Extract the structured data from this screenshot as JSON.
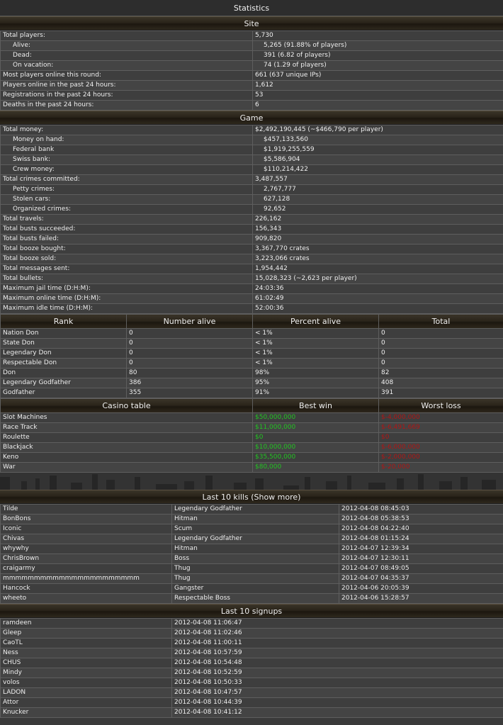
{
  "title": "Statistics",
  "site": {
    "heading": "Site",
    "rows": [
      {
        "label": "Total players:",
        "value": "5,730",
        "sub": false
      },
      {
        "label": "Alive:",
        "value": "5,265 (91.88% of players)",
        "sub": true
      },
      {
        "label": "Dead:",
        "value": "391 (6.82 of players)",
        "sub": true
      },
      {
        "label": "On vacation:",
        "value": "74 (1.29 of players)",
        "sub": true
      },
      {
        "label": "Most players online this round:",
        "value": "661 (637 unique IPs)",
        "sub": false
      },
      {
        "label": "Players online in the past 24 hours:",
        "value": "1,612",
        "sub": false
      },
      {
        "label": "Registrations in the past 24 hours:",
        "value": "53",
        "sub": false
      },
      {
        "label": "Deaths in the past 24 hours:",
        "value": "6",
        "sub": false
      }
    ]
  },
  "game": {
    "heading": "Game",
    "rows": [
      {
        "label": "Total money:",
        "value": "$2,492,190,445 (~$466,790 per player)",
        "sub": false
      },
      {
        "label": "Money on hand:",
        "value": "$457,133,560",
        "sub": true
      },
      {
        "label": "Federal bank",
        "value": "$1,919,255,559",
        "sub": true
      },
      {
        "label": "Swiss bank:",
        "value": "$5,586,904",
        "sub": true
      },
      {
        "label": "Crew money:",
        "value": "$110,214,422",
        "sub": true
      },
      {
        "label": "Total crimes committed:",
        "value": "3,487,557",
        "sub": false
      },
      {
        "label": "Petty crimes:",
        "value": "2,767,777",
        "sub": true
      },
      {
        "label": "Stolen cars:",
        "value": "627,128",
        "sub": true
      },
      {
        "label": "Organized crimes:",
        "value": "92,652",
        "sub": true
      },
      {
        "label": "Total travels:",
        "value": "226,162",
        "sub": false
      },
      {
        "label": "Total busts succeeded:",
        "value": "156,343",
        "sub": false
      },
      {
        "label": "Total busts failed:",
        "value": "909,820",
        "sub": false
      },
      {
        "label": "Total booze bought:",
        "value": "3,367,770 crates",
        "sub": false
      },
      {
        "label": "Total booze sold:",
        "value": "3,223,066 crates",
        "sub": false
      },
      {
        "label": "Total messages sent:",
        "value": "1,954,442",
        "sub": false
      },
      {
        "label": "Total bullets:",
        "value": "15,028,323 (~2,623 per player)",
        "sub": false
      },
      {
        "label": "Maximum jail time (D:H:M):",
        "value": "24:03:36",
        "sub": false
      },
      {
        "label": "Maximum online time (D:H:M):",
        "value": "61:02:49",
        "sub": false
      },
      {
        "label": "Maximum idle time (D:H:M):",
        "value": "52:00:36",
        "sub": false
      }
    ]
  },
  "rank": {
    "headers": [
      "Rank",
      "Number alive",
      "Percent alive",
      "Total"
    ],
    "rows": [
      [
        "Nation Don",
        "0",
        "< 1%",
        "0"
      ],
      [
        "State Don",
        "0",
        "< 1%",
        "0"
      ],
      [
        "Legendary Don",
        "0",
        "< 1%",
        "0"
      ],
      [
        "Respectable Don",
        "0",
        "< 1%",
        "0"
      ],
      [
        "Don",
        "80",
        "98%",
        "82"
      ],
      [
        "Legendary Godfather",
        "386",
        "95%",
        "408"
      ],
      [
        "Godfather",
        "355",
        "91%",
        "391"
      ]
    ]
  },
  "casino": {
    "headers": [
      "Casino table",
      "Best win",
      "Worst loss"
    ],
    "rows": [
      [
        "Slot Machines",
        "$50,000,000",
        "$-4,000,000"
      ],
      [
        "Race Track",
        "$11,000,000",
        "$-6,491,669"
      ],
      [
        "Roulette",
        "$0",
        "$0"
      ],
      [
        "Blackjack",
        "$10,000,000",
        "$-6,000,000"
      ],
      [
        "Keno",
        "$35,500,000",
        "$-2,000,000"
      ],
      [
        "War",
        "$80,000",
        "$-20,000"
      ]
    ],
    "colors": {
      "win": "#22c322",
      "loss": "#b01616"
    }
  },
  "kills": {
    "heading": "Last 10 kills (Show more)",
    "rows": [
      [
        "Tilde",
        "Legendary Godfather",
        "2012-04-08 08:45:03"
      ],
      [
        "BonBons",
        "Hitman",
        "2012-04-08 05:38:53"
      ],
      [
        "Iconic",
        "Scum",
        "2012-04-08 04:22:40"
      ],
      [
        "Chivas",
        "Legendary Godfather",
        "2012-04-08 01:15:24"
      ],
      [
        "whywhy",
        "Hitman",
        "2012-04-07 12:39:34"
      ],
      [
        "ChrisBrown",
        "Boss",
        "2012-04-07 12:30:11"
      ],
      [
        "craigarmy",
        "Thug",
        "2012-04-07 08:49:05"
      ],
      [
        "mmmmmmmmmmmmmmmmmmmmmm",
        "Thug",
        "2012-04-07 04:35:37"
      ],
      [
        "Hancock",
        "Gangster",
        "2012-04-06 20:05:39"
      ],
      [
        "wheeto",
        "Respectable Boss",
        "2012-04-06 15:28:57"
      ]
    ]
  },
  "signups": {
    "heading": "Last 10 signups",
    "rows": [
      [
        "ramdeen",
        "2012-04-08 11:06:47"
      ],
      [
        "Gleep",
        "2012-04-08 11:02:46"
      ],
      [
        "CaoTL",
        "2012-04-08 11:00:11"
      ],
      [
        "Ness",
        "2012-04-08 10:57:59"
      ],
      [
        "CHUS",
        "2012-04-08 10:54:48"
      ],
      [
        "Mindy",
        "2012-04-08 10:52:59"
      ],
      [
        "volos",
        "2012-04-08 10:50:33"
      ],
      [
        "LADON",
        "2012-04-08 10:47:57"
      ],
      [
        "Attor",
        "2012-04-08 10:44:39"
      ],
      [
        "Knucker",
        "2012-04-08 10:41:12"
      ]
    ]
  }
}
